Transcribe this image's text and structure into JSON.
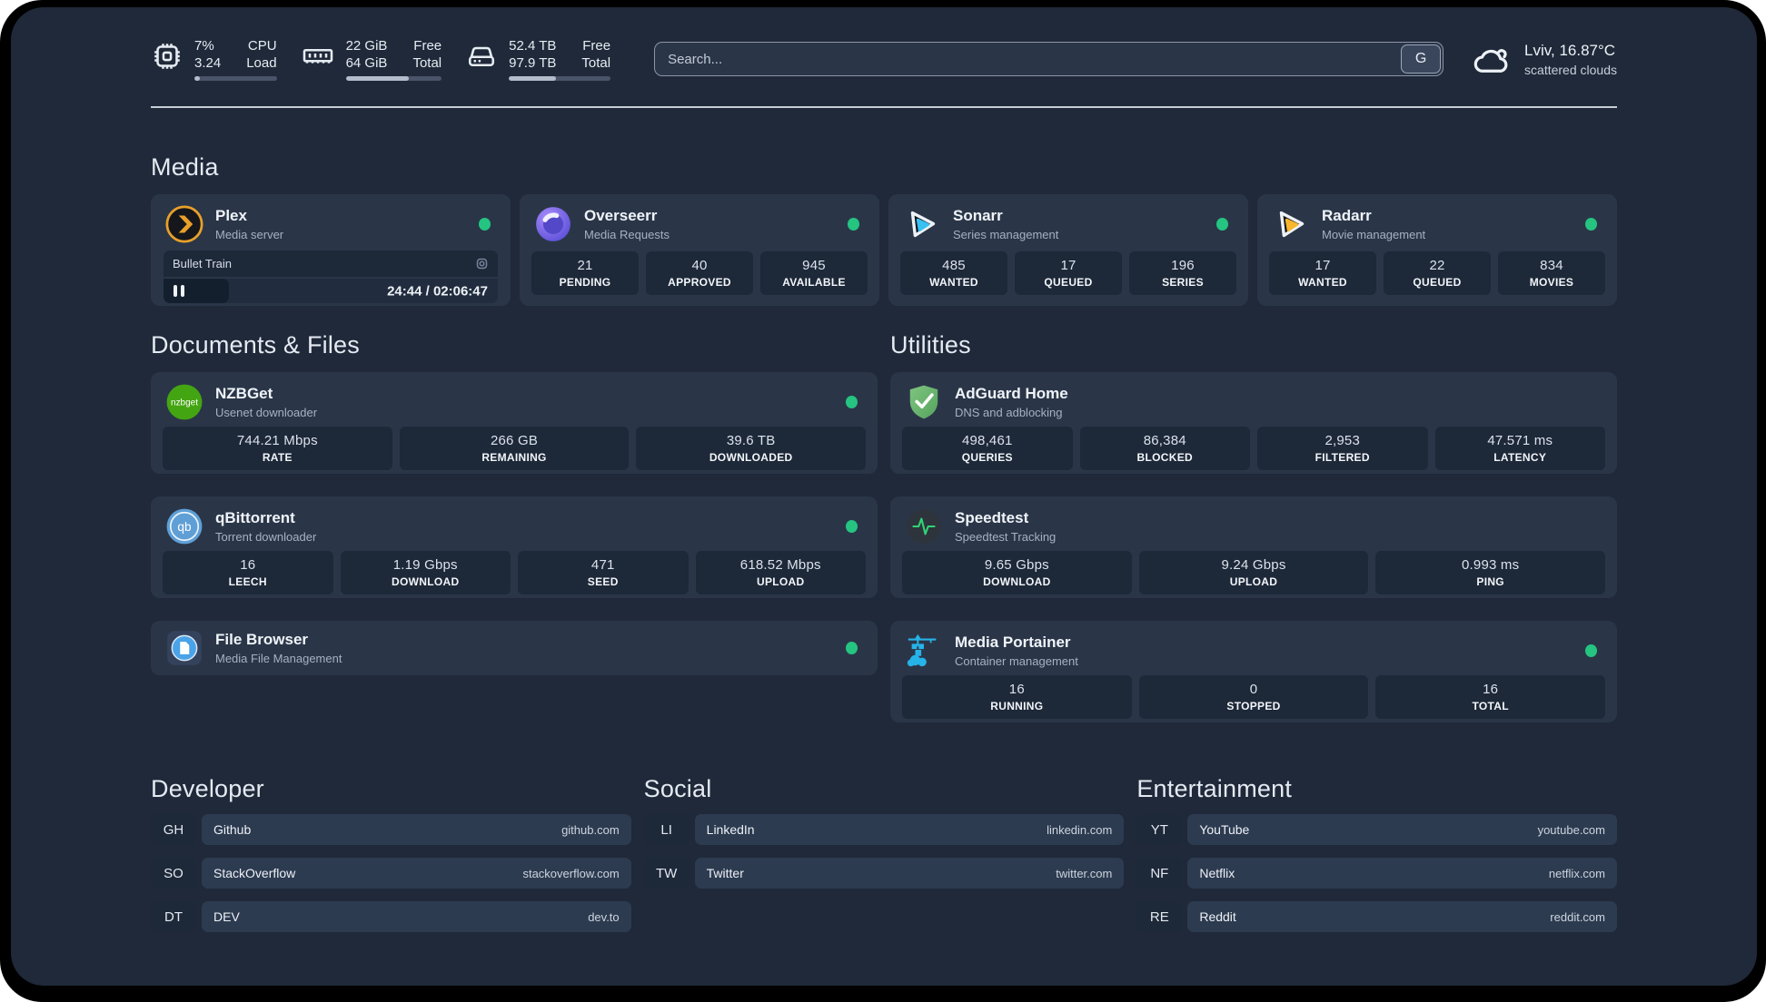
{
  "topbar": {
    "cpu": {
      "value": "7%",
      "sub": "3.24",
      "label_top": "CPU",
      "label_bottom": "Load",
      "bar_pct": 7
    },
    "ram": {
      "value": "22 GiB",
      "sub": "64 GiB",
      "label_top": "Free",
      "label_bottom": "Total",
      "bar_pct": 66
    },
    "disk": {
      "value": "52.4 TB",
      "sub": "97.9 TB",
      "label_top": "Free",
      "label_bottom": "Total",
      "bar_pct": 46
    },
    "search": {
      "placeholder": "Search...",
      "engine_label": "G"
    },
    "weather": {
      "location_temp": "Lviv, 16.87°C",
      "condition": "scattered clouds"
    }
  },
  "media": {
    "title": "Media",
    "apps": [
      {
        "name": "Plex",
        "desc": "Media server",
        "player": {
          "title": "Bullet Train",
          "time": "24:44 / 02:06:47",
          "progress_pct": 19.5
        }
      },
      {
        "name": "Overseerr",
        "desc": "Media Requests",
        "stats": [
          {
            "value": "21",
            "label": "PENDING"
          },
          {
            "value": "40",
            "label": "APPROVED"
          },
          {
            "value": "945",
            "label": "AVAILABLE"
          }
        ]
      },
      {
        "name": "Sonarr",
        "desc": "Series management",
        "stats": [
          {
            "value": "485",
            "label": "WANTED"
          },
          {
            "value": "17",
            "label": "QUEUED"
          },
          {
            "value": "196",
            "label": "SERIES"
          }
        ]
      },
      {
        "name": "Radarr",
        "desc": "Movie management",
        "stats": [
          {
            "value": "17",
            "label": "WANTED"
          },
          {
            "value": "22",
            "label": "QUEUED"
          },
          {
            "value": "834",
            "label": "MOVIES"
          }
        ]
      }
    ]
  },
  "documents": {
    "title": "Documents & Files",
    "apps": [
      {
        "name": "NZBGet",
        "desc": "Usenet downloader",
        "stats": [
          {
            "value": "744.21 Mbps",
            "label": "RATE"
          },
          {
            "value": "266 GB",
            "label": "REMAINING"
          },
          {
            "value": "39.6 TB",
            "label": "DOWNLOADED"
          }
        ]
      },
      {
        "name": "qBittorrent",
        "desc": "Torrent downloader",
        "stats": [
          {
            "value": "16",
            "label": "LEECH"
          },
          {
            "value": "1.19 Gbps",
            "label": "DOWNLOAD"
          },
          {
            "value": "471",
            "label": "SEED"
          },
          {
            "value": "618.52 Mbps",
            "label": "UPLOAD"
          }
        ]
      },
      {
        "name": "File Browser",
        "desc": "Media File Management"
      }
    ]
  },
  "utilities": {
    "title": "Utilities",
    "apps": [
      {
        "name": "AdGuard Home",
        "desc": "DNS and adblocking",
        "stats": [
          {
            "value": "498,461",
            "label": "QUERIES"
          },
          {
            "value": "86,384",
            "label": "BLOCKED"
          },
          {
            "value": "2,953",
            "label": "FILTERED"
          },
          {
            "value": "47.571 ms",
            "label": "LATENCY"
          }
        ]
      },
      {
        "name": "Speedtest",
        "desc": "Speedtest Tracking",
        "stats": [
          {
            "value": "9.65 Gbps",
            "label": "DOWNLOAD"
          },
          {
            "value": "9.24 Gbps",
            "label": "UPLOAD"
          },
          {
            "value": "0.993 ms",
            "label": "PING"
          }
        ]
      },
      {
        "name": "Media Portainer",
        "desc": "Container management",
        "stats": [
          {
            "value": "16",
            "label": "RUNNING"
          },
          {
            "value": "0",
            "label": "STOPPED"
          },
          {
            "value": "16",
            "label": "TOTAL"
          }
        ]
      }
    ]
  },
  "bookmarks": {
    "developer": {
      "title": "Developer",
      "items": [
        {
          "abbr": "GH",
          "name": "Github",
          "url": "github.com"
        },
        {
          "abbr": "SO",
          "name": "StackOverflow",
          "url": "stackoverflow.com"
        },
        {
          "abbr": "DT",
          "name": "DEV",
          "url": "dev.to"
        }
      ]
    },
    "social": {
      "title": "Social",
      "items": [
        {
          "abbr": "LI",
          "name": "LinkedIn",
          "url": "linkedin.com"
        },
        {
          "abbr": "TW",
          "name": "Twitter",
          "url": "twitter.com"
        }
      ]
    },
    "entertainment": {
      "title": "Entertainment",
      "items": [
        {
          "abbr": "YT",
          "name": "YouTube",
          "url": "youtube.com"
        },
        {
          "abbr": "NF",
          "name": "Netflix",
          "url": "netflix.com"
        },
        {
          "abbr": "RE",
          "name": "Reddit",
          "url": "reddit.com"
        }
      ]
    }
  },
  "colors": {
    "status_green": "#25c481",
    "plex_orange": "#e8a02a",
    "sonarr_blue": "#38c1f1",
    "radarr_yellow": "#f8b62c",
    "nzbget_green": "#44a512",
    "qbittorrent_blue": "#5f9fd6",
    "adguard_green": "#68b470",
    "portainer_blue": "#26b3e8",
    "overseerr_purple": "#6c5ce7"
  }
}
